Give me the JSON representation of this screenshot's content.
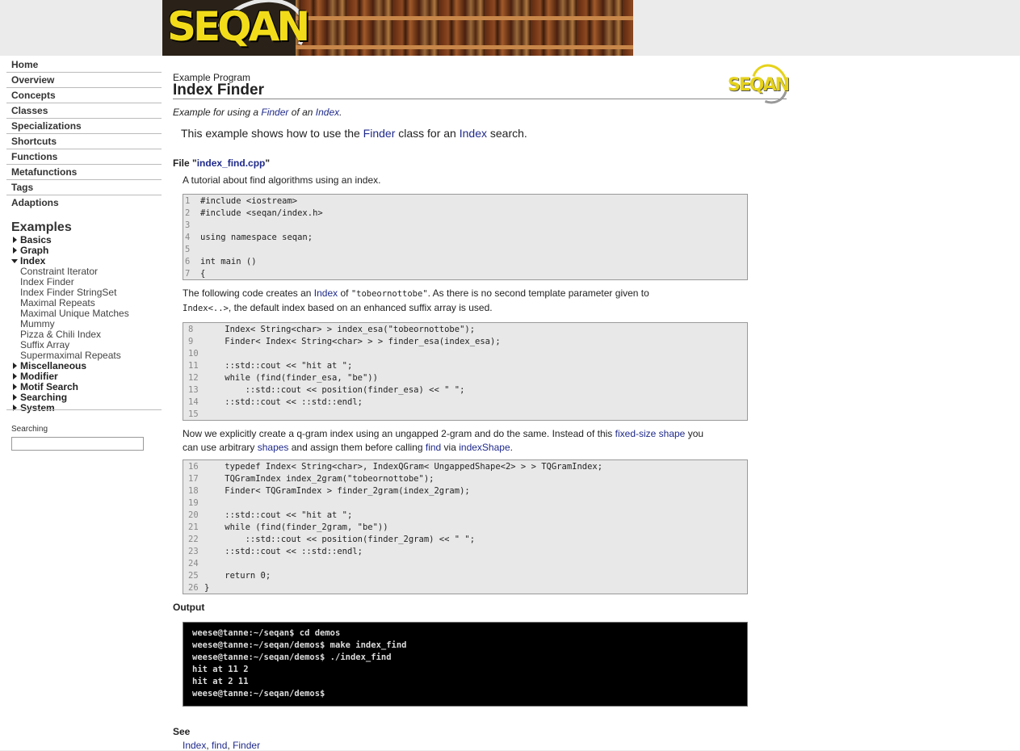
{
  "banner": {
    "logo_text": "SEQAN"
  },
  "nav": {
    "items": [
      "Home",
      "Overview",
      "Concepts",
      "Classes",
      "Specializations",
      "Shortcuts",
      "Functions",
      "Metafunctions",
      "Tags",
      "Adaptions"
    ],
    "examples_heading": "Examples",
    "groups": {
      "basics": "Basics",
      "graph": "Graph",
      "index": "Index",
      "misc": "Miscellaneous",
      "modifier": "Modifier",
      "motif": "Motif Search",
      "searching": "Searching",
      "system": "System"
    },
    "index_children": [
      "Constraint Iterator",
      "Index Finder",
      "Index Finder StringSet",
      "Maximal Repeats",
      "Maximal Unique Matches",
      "Mummy",
      "Pizza & Chili Index",
      "Suffix Array",
      "Supermaximal Repeats"
    ],
    "search_label": "Searching",
    "search_value": ""
  },
  "page": {
    "kicker": "Example Program",
    "title": "Index Finder",
    "mini_logo": "SEQAN",
    "summary_pre": "Example for using a ",
    "summary_link1": "Finder",
    "summary_mid": " of an ",
    "summary_link2": "Index",
    "summary_post": ".",
    "intro_pre": "This example shows how to use the ",
    "intro_link1": "Finder",
    "intro_mid": " class for an ",
    "intro_link2": "Index",
    "intro_post": " search.",
    "file_label": "File \"",
    "file_name": "index_find.cpp",
    "file_close": "\"",
    "file_desc": "A tutorial about find algorithms using an index."
  },
  "code1": [
    {
      "n": "1",
      "t": "#include <iostream>"
    },
    {
      "n": "2",
      "t": "#include <seqan/index.h>"
    },
    {
      "n": "3",
      "t": ""
    },
    {
      "n": "4",
      "t": "using namespace seqan;"
    },
    {
      "n": "5",
      "t": ""
    },
    {
      "n": "6",
      "t": "int main ()"
    },
    {
      "n": "7",
      "t": "{"
    }
  ],
  "para1": {
    "a": "The following code creates an ",
    "link1": "Index",
    "b": " of ",
    "code1": "\"tobeornottobe\"",
    "c": ". As there is no second template parameter given to",
    "code2": "Index<..>",
    "d": ", the default index based on an enhanced suffix array is used."
  },
  "code2": [
    {
      "n": "8",
      "t": "    Index< String<char> > index_esa(\"tobeornottobe\");"
    },
    {
      "n": "9",
      "t": "    Finder< Index< String<char> > > finder_esa(index_esa);"
    },
    {
      "n": "10",
      "t": ""
    },
    {
      "n": "11",
      "t": "    ::std::cout << \"hit at \";"
    },
    {
      "n": "12",
      "t": "    while (find(finder_esa, \"be\"))"
    },
    {
      "n": "13",
      "t": "        ::std::cout << position(finder_esa) << \" \";"
    },
    {
      "n": "14",
      "t": "    ::std::cout << ::std::endl;"
    },
    {
      "n": "15",
      "t": ""
    }
  ],
  "para2": {
    "a": "Now we explicitly create a q-gram index using an ungapped 2-gram and do the same. Instead of this ",
    "link1": "fixed-size shape",
    "b": " you",
    "c": "can use arbitrary ",
    "link2": "shapes",
    "d": " and assign them before calling ",
    "link3": "find",
    "e": " via ",
    "link4": "indexShape",
    "f": "."
  },
  "code3": [
    {
      "n": "16",
      "t": "    typedef Index< String<char>, IndexQGram< UngappedShape<2> > > TQGramIndex;"
    },
    {
      "n": "17",
      "t": "    TQGramIndex index_2gram(\"tobeornottobe\");"
    },
    {
      "n": "18",
      "t": "    Finder< TQGramIndex > finder_2gram(index_2gram);"
    },
    {
      "n": "19",
      "t": ""
    },
    {
      "n": "20",
      "t": "    ::std::cout << \"hit at \";"
    },
    {
      "n": "21",
      "t": "    while (find(finder_2gram, \"be\"))"
    },
    {
      "n": "22",
      "t": "        ::std::cout << position(finder_2gram) << \" \";"
    },
    {
      "n": "23",
      "t": "    ::std::cout << ::std::endl;"
    },
    {
      "n": "24",
      "t": ""
    },
    {
      "n": "25",
      "t": "    return 0;"
    },
    {
      "n": "26",
      "t": "}"
    }
  ],
  "output": {
    "heading": "Output",
    "lines": [
      "weese@tanne:~/seqan$ cd demos",
      "weese@tanne:~/seqan/demos$ make index_find",
      "weese@tanne:~/seqan/demos$ ./index_find",
      "hit at 11 2",
      "hit at 2 11",
      "weese@tanne:~/seqan/demos$"
    ]
  },
  "see": {
    "heading": "See",
    "links": [
      "Index",
      "find",
      "Finder"
    ],
    "sep": ", "
  },
  "colors": {
    "link": "#1f2a8a",
    "code_bg": "#e8e8e8",
    "logo_yellow": "#f2dc1a"
  }
}
